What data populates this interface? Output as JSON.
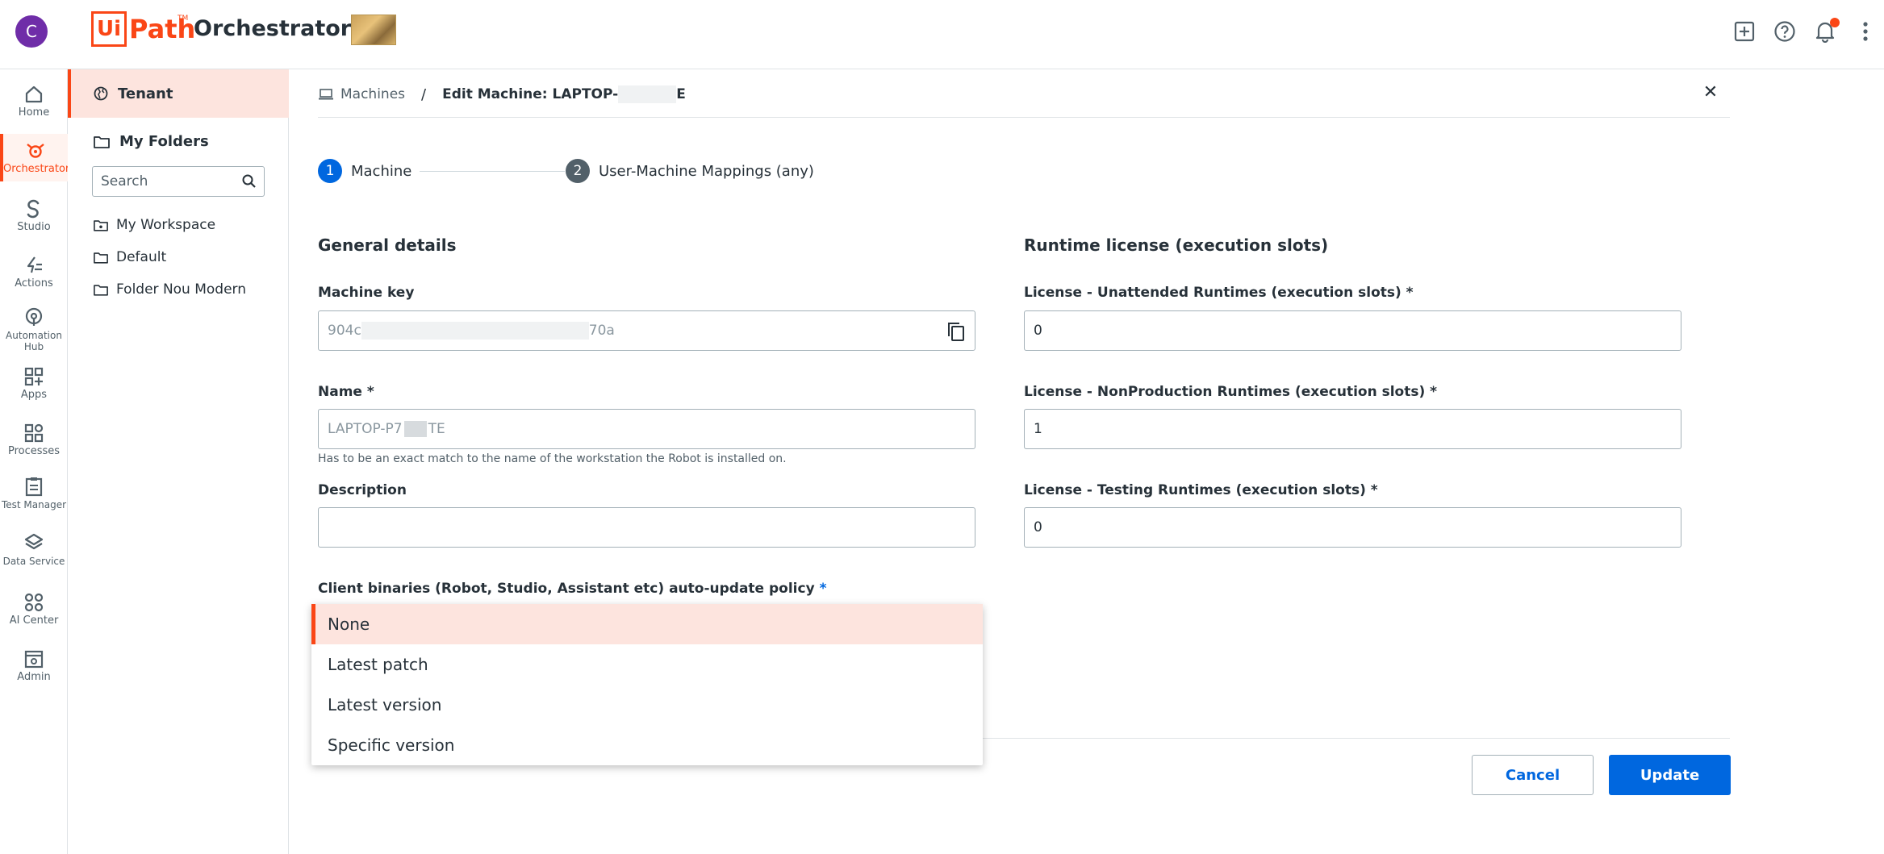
{
  "header": {
    "avatar_letter": "C",
    "logo_ui": "Ui",
    "logo_path": "Path",
    "logo_tm": "TM",
    "product": "Orchestrator"
  },
  "rail": {
    "items": [
      {
        "label": "Home",
        "icon": "home-icon"
      },
      {
        "label": "Orchestrator",
        "icon": "orchestrator-icon",
        "active": true
      },
      {
        "label": "Studio",
        "icon": "studio-icon"
      },
      {
        "label": "Actions",
        "icon": "actions-icon"
      },
      {
        "label": "Automation Hub",
        "icon": "automation-hub-icon"
      },
      {
        "label": "Apps",
        "icon": "apps-icon"
      },
      {
        "label": "Processes",
        "icon": "processes-icon"
      },
      {
        "label": "Test Manager",
        "icon": "test-manager-icon"
      },
      {
        "label": "Data Service",
        "icon": "data-service-icon"
      },
      {
        "label": "AI Center",
        "icon": "ai-center-icon"
      },
      {
        "label": "Admin",
        "icon": "admin-icon"
      }
    ]
  },
  "folders": {
    "tenant": "Tenant",
    "my_folders": "My Folders",
    "search_placeholder": "Search",
    "items": [
      "My Workspace",
      "Default",
      "Folder Nou Modern"
    ]
  },
  "breadcrumb": {
    "parent": "Machines",
    "separator": "/",
    "current_prefix": "Edit Machine: LAPTOP-",
    "current_suffix": "E"
  },
  "steps": [
    {
      "number": "1",
      "label": "Machine"
    },
    {
      "number": "2",
      "label": "User-Machine Mappings (any)"
    }
  ],
  "general": {
    "title": "General details",
    "machine_key_label": "Machine key",
    "machine_key_start": "904c",
    "machine_key_end": "70a",
    "name_label": "Name *",
    "name_start": "LAPTOP-P7",
    "name_end": "TE",
    "name_hint": "Has to be an exact match to the name of the workstation the Robot is installed on.",
    "description_label": "Description",
    "description_value": "",
    "policy_label": "Client binaries (Robot, Studio, Assistant etc) auto-update policy",
    "policy_required": "*"
  },
  "runtime": {
    "title": "Runtime license (execution slots)",
    "unattended_label": "License - Unattended Runtimes (execution slots) *",
    "unattended_value": "0",
    "nonprod_label": "License - NonProduction Runtimes (execution slots) *",
    "nonprod_value": "1",
    "testing_label": "License - Testing Runtimes (execution slots) *",
    "testing_value": "0"
  },
  "policy_options": [
    "None",
    "Latest patch",
    "Latest version",
    "Specific version"
  ],
  "actions": {
    "cancel": "Cancel",
    "update": "Update"
  },
  "colors": {
    "brand": "#fa4616",
    "accent": "#0067df",
    "step_active": "#0067df",
    "step_inactive": "#526069"
  }
}
